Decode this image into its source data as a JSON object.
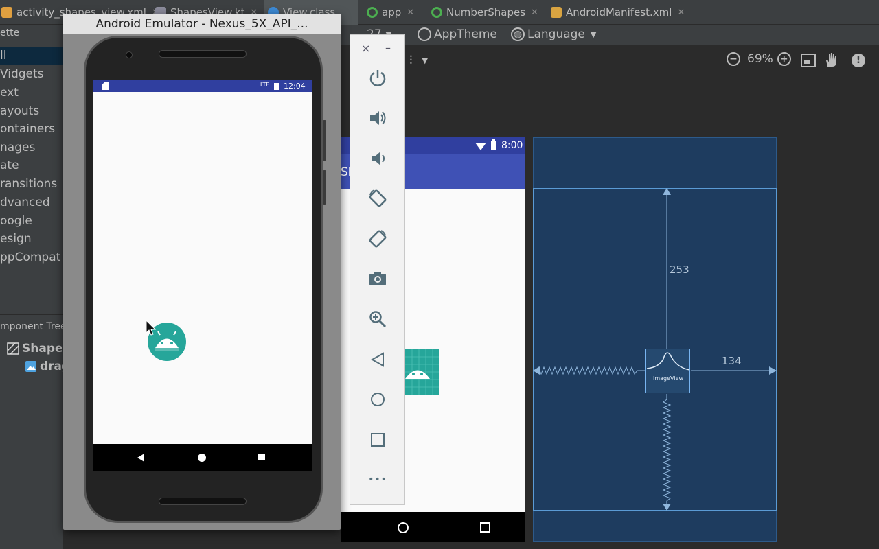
{
  "tabs": [
    {
      "label": "activity_shapes_view.xml",
      "active": false
    },
    {
      "label": "ShapesView.kt",
      "active": false
    },
    {
      "label": "View.class",
      "active": true
    },
    {
      "label": "app",
      "active": false
    },
    {
      "label": "NumberShapes",
      "active": false
    },
    {
      "label": "AndroidManifest.xml",
      "active": false
    }
  ],
  "palette": {
    "title": "ette",
    "items": [
      "ll",
      "Vidgets",
      "ext",
      "ayouts",
      "ontainers",
      "nages",
      "ate",
      "ransitions",
      "dvanced",
      "oogle",
      "esign",
      "ppCompat"
    ],
    "selected_index": 0
  },
  "component_tree": {
    "title": "mponent Tree",
    "rows": [
      "Shapes",
      "drag"
    ]
  },
  "toolbar": {
    "api_level": "27",
    "theme": "AppTheme",
    "language": "Language",
    "zoom": "69%"
  },
  "emulator": {
    "title": "Android Emulator - Nexus_5X_API_...",
    "clock": "12:04",
    "signal_label": "LTE"
  },
  "preview": {
    "clock": "8:00",
    "app_title": "Sh"
  },
  "blueprint": {
    "view_label": "ImageView",
    "top_margin": "253",
    "end_margin": "134"
  },
  "emu_tools": {
    "close": "×",
    "minimize": "–",
    "more": "•••"
  },
  "icons": {
    "power": "power-icon",
    "volume_up": "volume-up-icon",
    "volume_down": "volume-down-icon",
    "rotate_left": "rotate-left-icon",
    "rotate_right": "rotate-right-icon",
    "camera": "camera-icon",
    "zoom": "zoom-icon",
    "back": "back-icon",
    "home": "home-icon",
    "overview": "overview-icon",
    "pan": "hand-icon",
    "warning": "warning-icon"
  },
  "colors": {
    "ide_bg": "#2b2b2b",
    "panel_bg": "#3c3f41",
    "primary": "#3f51b5",
    "primary_dark": "#303f9f",
    "android_teal": "#26a69a",
    "blueprint_bg": "#1e3c5f",
    "blueprint_line": "#5b9bd5"
  }
}
